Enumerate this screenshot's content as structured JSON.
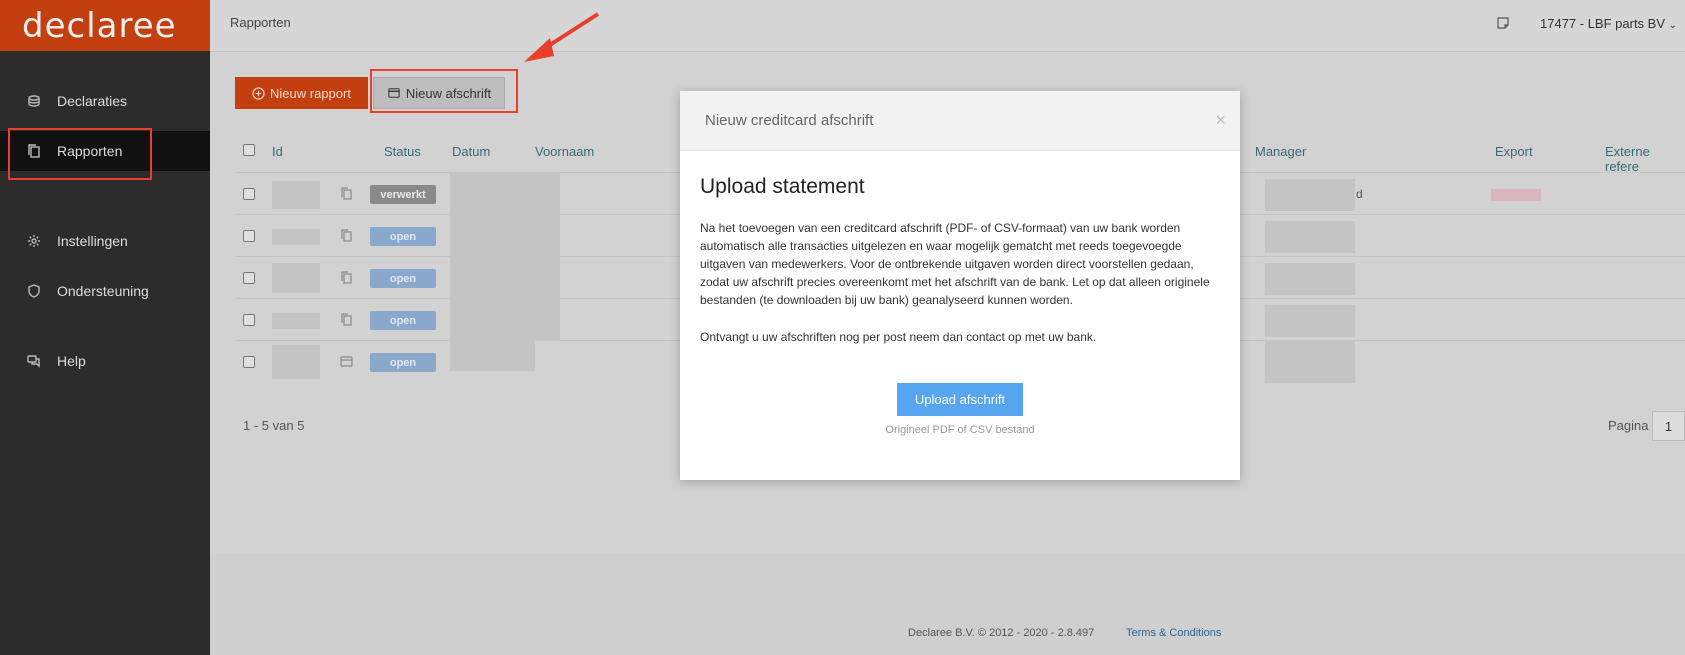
{
  "brand": {
    "logo_text": "declaree"
  },
  "sidebar": {
    "items": [
      {
        "label": "Declaraties",
        "icon": "coins-icon"
      },
      {
        "label": "Rapporten",
        "icon": "documents-icon",
        "active": true
      },
      {
        "label": "Instellingen",
        "icon": "gear-icon"
      },
      {
        "label": "Ondersteuning",
        "icon": "shield-icon"
      },
      {
        "label": "Help",
        "icon": "chat-icon"
      }
    ]
  },
  "topbar": {
    "breadcrumb": "Rapporten",
    "company": "17477 - LBF parts BV"
  },
  "toolbar": {
    "new_report_label": "Nieuw rapport",
    "new_statement_label": "Nieuw afschrift"
  },
  "table": {
    "columns": [
      "Id",
      "Status",
      "Datum",
      "Voornaam",
      "Manager",
      "Export",
      "Externe refere"
    ],
    "rows": [
      {
        "status": "verwerkt",
        "icon": "copy-icon"
      },
      {
        "status": "open",
        "icon": "copy-icon"
      },
      {
        "status": "open",
        "icon": "copy-icon"
      },
      {
        "status": "open",
        "icon": "copy-icon"
      },
      {
        "status": "open",
        "icon": "credit-card-icon"
      }
    ],
    "row5_manager_suffix": "d"
  },
  "pagination": {
    "count": "1 - 5 van 5",
    "label": "Pagina",
    "page": "1"
  },
  "footer": {
    "copyright": "Declaree B.V. © 2012 - 2020 - 2.8.497",
    "terms": "Terms & Conditions"
  },
  "modal": {
    "title": "Nieuw creditcard afschrift",
    "close": "×",
    "heading": "Upload statement",
    "paragraph1": "Na het toevoegen van een creditcard afschrift (PDF- of CSV-formaat) van uw bank worden automatisch alle transacties uitgelezen en waar mogelijk gematcht met reeds toegevoegde uitgaven van medewerkers. Voor de ontbrekende uitgaven worden direct voorstellen gedaan, zodat uw afschrift precies overeenkomt met het afschrift van de bank. Let op dat alleen originele bestanden (te downloaden bij uw bank) geanalyseerd kunnen worden.",
    "paragraph2": "Ontvangt u uw afschriften nog per post neem dan contact op met uw bank.",
    "upload_label": "Upload afschrift",
    "upload_hint": "Origineel PDF of CSV bestand"
  },
  "colors": {
    "brand": "#c43f0f",
    "sidebar": "#2c2c2c",
    "upload_button": "#56a5f0",
    "annotation": "#e8402a"
  }
}
